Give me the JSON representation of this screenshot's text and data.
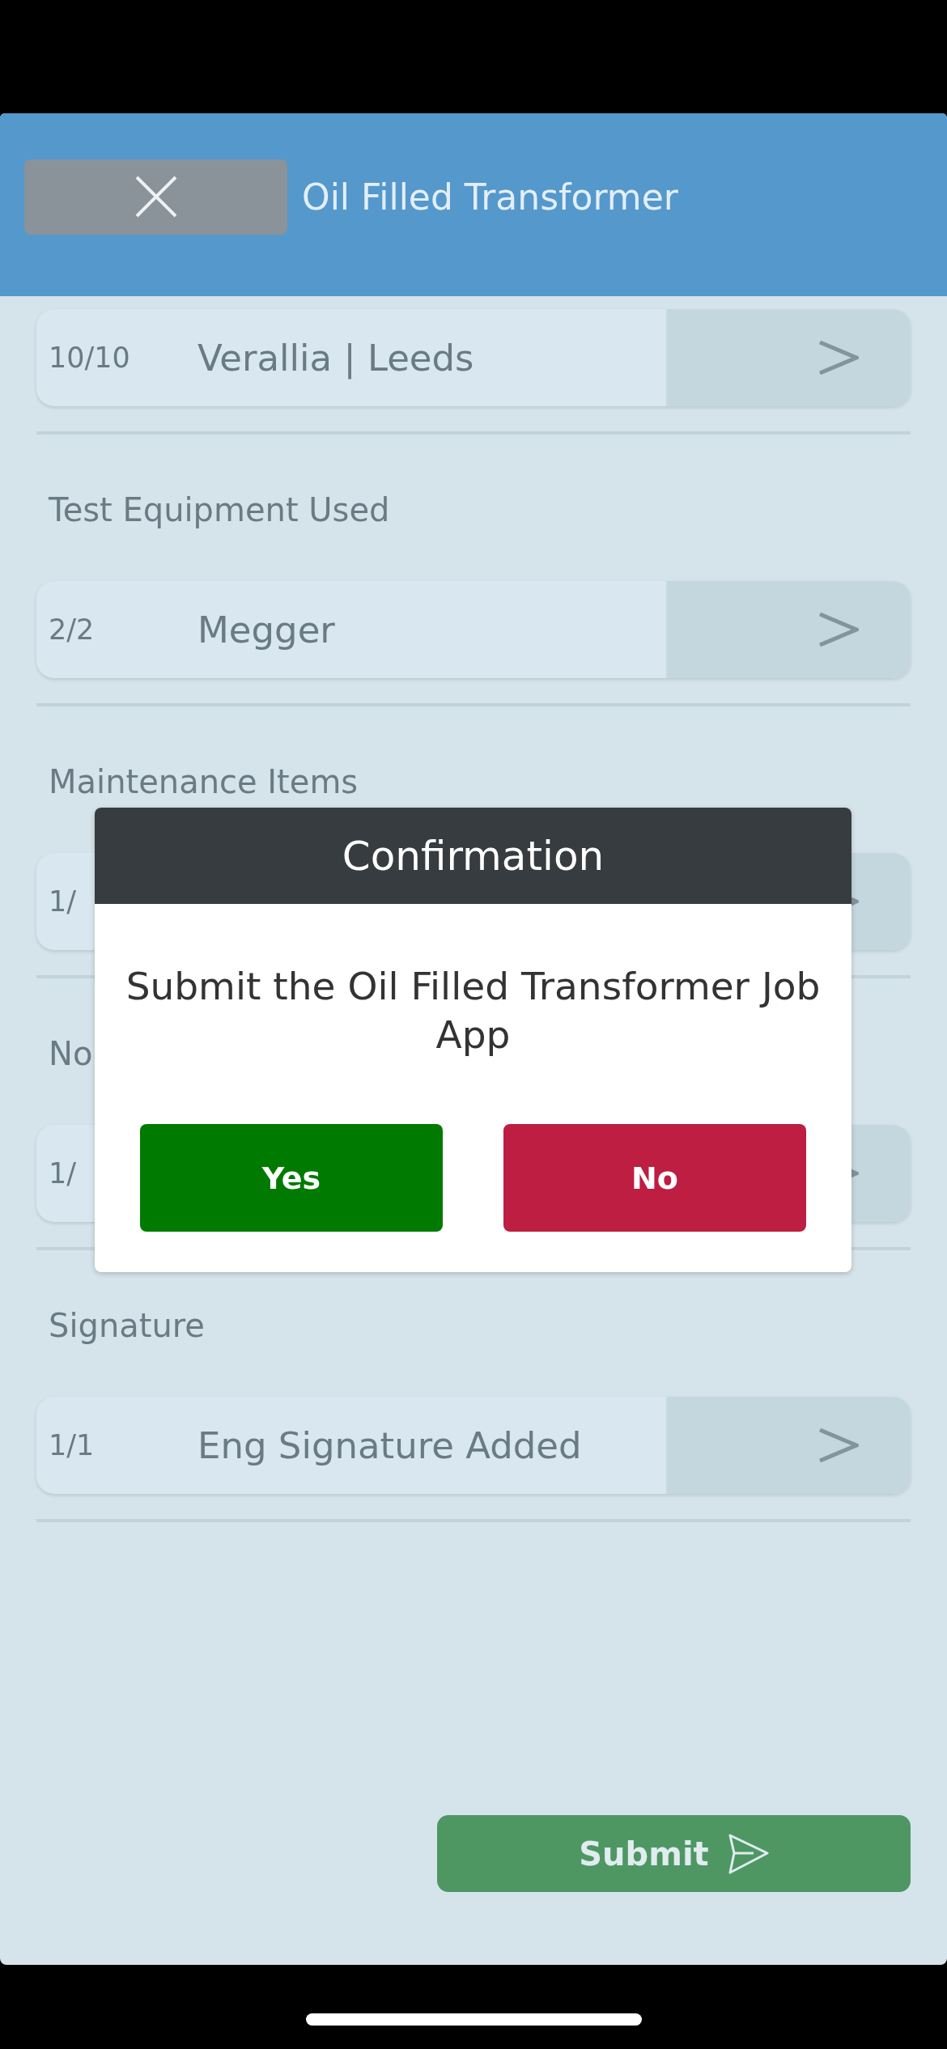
{
  "header": {
    "title": "Oil Filled Transformer"
  },
  "sections": [
    {
      "count": "10/10",
      "value": "Verallia | Leeds"
    },
    {
      "label": "Test Equipment Used",
      "count": "2/2",
      "value": "Megger"
    },
    {
      "label": "Maintenance Items",
      "count": "1/"
    },
    {
      "label": "No",
      "count": "1/"
    },
    {
      "label": "Signature",
      "count": "1/1",
      "value": "Eng Signature Added"
    }
  ],
  "submit": {
    "label": "Submit"
  },
  "dialog": {
    "title": "Confirmation",
    "message": "Submit the Oil Filled Transformer Job App",
    "buttons": [
      {
        "label": "Yes",
        "kind": "confirm"
      },
      {
        "label": "No",
        "kind": "cancel"
      }
    ]
  }
}
